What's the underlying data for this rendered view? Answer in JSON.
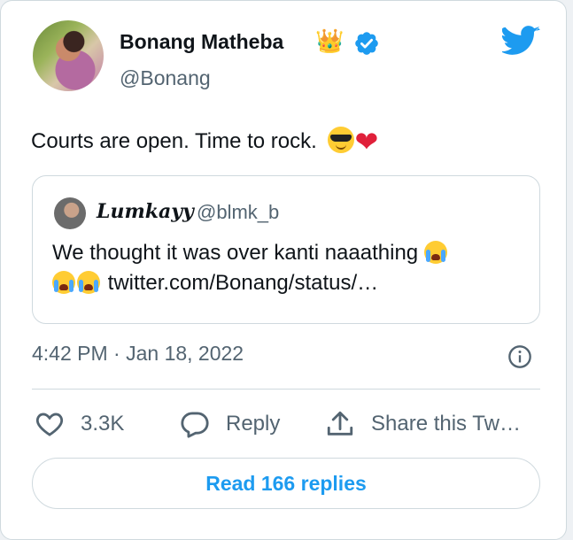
{
  "author": {
    "name": "Bonang Matheba",
    "crown_emoji": "👑",
    "handle": "@Bonang"
  },
  "tweet": {
    "text": "Courts are open. Time to rock.",
    "heart_emoji": "❤"
  },
  "quoted": {
    "name": "Lumkayy",
    "handle": "@blmk_b",
    "text": "We thought it was over kanti naaathing",
    "link": "twitter.com/Bonang/status/…"
  },
  "timestamp": "4:42 PM · Jan 18, 2022",
  "actions": {
    "likes_count": "3.3K",
    "reply_label": "Reply",
    "share_label": "Share this Tw…"
  },
  "read_replies_label": "Read 166 replies",
  "icons": [
    "verified-badge-icon",
    "twitter-bird-icon",
    "info-icon",
    "heart-icon",
    "reply-bubble-icon",
    "share-icon"
  ],
  "colors": {
    "accent": "#1d9bf0",
    "text_secondary": "#536471",
    "border": "#cfd9de",
    "heart": "#e0203a"
  }
}
